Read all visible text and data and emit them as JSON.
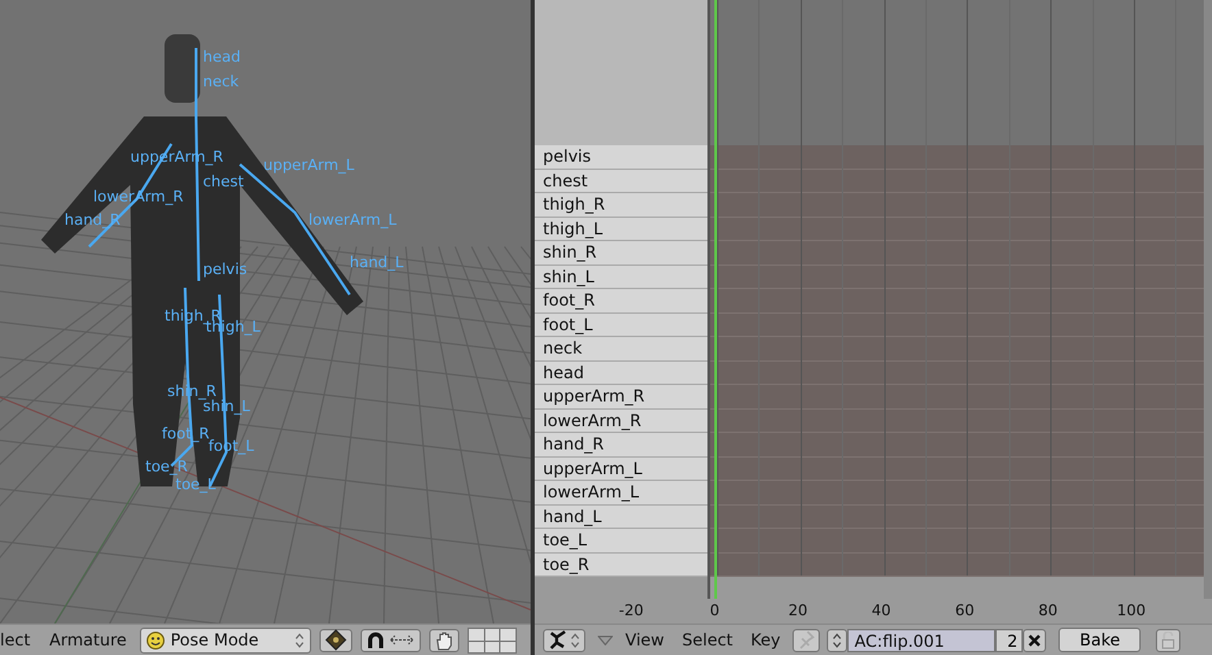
{
  "viewport": {
    "bone_labels": [
      "head",
      "neck",
      "upperArm_R",
      "chest",
      "upperArm_L",
      "lowerArm_R",
      "hand_R",
      "lowerArm_L",
      "pelvis",
      "hand_L",
      "thigh_R",
      "thigh_L",
      "shin_R",
      "shin_L",
      "foot_R",
      "foot_L",
      "toe_R",
      "toe_L"
    ]
  },
  "viewport_header": {
    "menus": [
      "lect",
      "Armature"
    ],
    "mode": "Pose Mode"
  },
  "action_editor": {
    "channels": [
      "pelvis",
      "chest",
      "thigh_R",
      "thigh_L",
      "shin_R",
      "shin_L",
      "foot_R",
      "foot_L",
      "neck",
      "head",
      "upperArm_R",
      "lowerArm_R",
      "hand_R",
      "upperArm_L",
      "lowerArm_L",
      "hand_L",
      "toe_L",
      "toe_R"
    ],
    "ruler": [
      "-20",
      "0",
      "20",
      "40",
      "60",
      "80",
      "100"
    ]
  },
  "action_header": {
    "menus": [
      "View",
      "Select",
      "Key"
    ],
    "action": "AC:flip.001",
    "users": "2",
    "bake": "Bake"
  }
}
